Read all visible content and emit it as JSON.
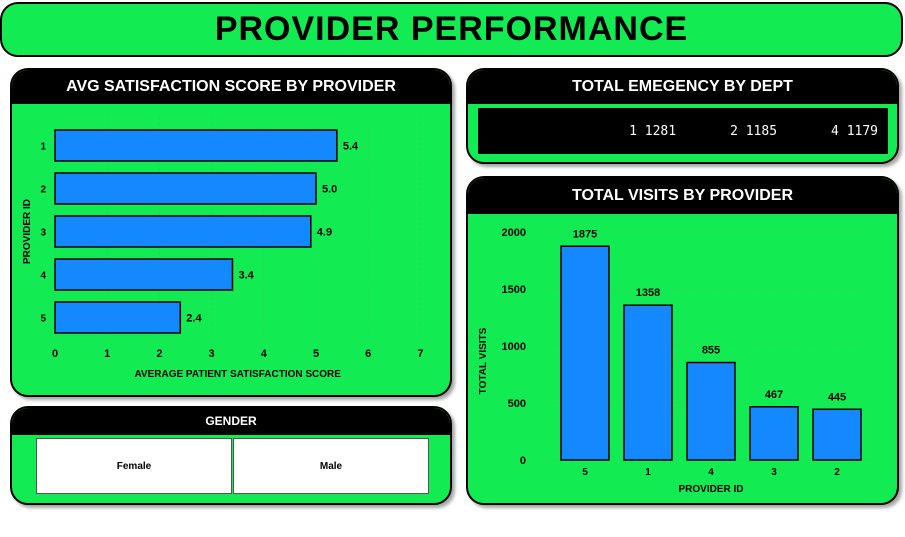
{
  "page_title": "PROVIDER PERFORMANCE",
  "satisfaction": {
    "title": "AVG SATISFACTION SCORE BY PROVIDER",
    "chart_data": {
      "type": "bar",
      "orientation": "horizontal",
      "categories": [
        "1",
        "2",
        "3",
        "4",
        "5"
      ],
      "values": [
        5.4,
        5.0,
        4.9,
        3.4,
        2.4
      ],
      "value_labels": [
        "5.4",
        "5.0",
        "4.9",
        "3.4",
        "2.4"
      ],
      "xlabel": "AVERAGE PATIENT SATISFACTION SCORE",
      "ylabel": "PROVIDER ID",
      "xlim": [
        0,
        7
      ],
      "xticks": [
        "0",
        "1",
        "2",
        "3",
        "4",
        "5",
        "6",
        "7"
      ],
      "bar_color": "#1488ff",
      "grid": true
    }
  },
  "emergency": {
    "title": "TOTAL EMEGENCY BY DEPT",
    "items": [
      {
        "dept": "1",
        "value": "1281"
      },
      {
        "dept": "2",
        "value": "1185"
      },
      {
        "dept": "4",
        "value": "1179"
      }
    ]
  },
  "visits": {
    "title": "TOTAL VISITS BY PROVIDER",
    "chart_data": {
      "type": "bar",
      "categories": [
        "5",
        "1",
        "4",
        "3",
        "2"
      ],
      "values": [
        1875,
        1358,
        855,
        467,
        445
      ],
      "value_labels": [
        "1875",
        "1358",
        "855",
        "467",
        "445"
      ],
      "xlabel": "PROVIDER ID",
      "ylabel": "TOTAL VISITS",
      "ylim": [
        0,
        2000
      ],
      "yticks": [
        "0",
        "500",
        "1000",
        "1500",
        "2000"
      ],
      "bar_color": "#1488ff",
      "grid": true
    }
  },
  "gender": {
    "title": "GENDER",
    "options": [
      "Female",
      "Male"
    ]
  },
  "colors": {
    "panel_green": "#13eb52",
    "header_black": "#000000",
    "bar_blue": "#1488ff"
  }
}
